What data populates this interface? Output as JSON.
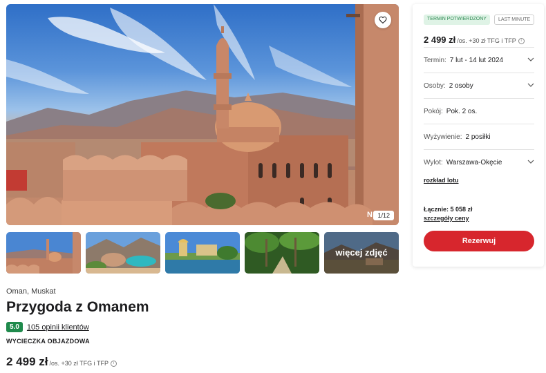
{
  "gallery": {
    "counter": "1/12",
    "corner_text": "N",
    "favorite_icon": "heart-icon",
    "more_photos_label": "więcej zdjęć"
  },
  "offer": {
    "location": "Oman, Muskat",
    "title": "Przygoda z Omanem",
    "rating": "5.0",
    "reviews_link": "105 opinii klientów",
    "trip_type": "WYCIECZKA OBJAZDOWA",
    "price": "2 499 zł",
    "price_suffix": "/os. +30 zł TFG i TFP"
  },
  "booking": {
    "tags": [
      "TERMIN POTWIERDZONY",
      "LAST MINUTE"
    ],
    "price": "2 499 zł",
    "price_suffix": "/os. +30 zł TFG i TFP",
    "fields": {
      "term": {
        "label": "Termin:",
        "value": "7 lut - 14 lut 2024"
      },
      "persons": {
        "label": "Osoby:",
        "value": "2 osoby"
      },
      "room": {
        "label": "Pokój:",
        "value": "Pok. 2 os."
      },
      "board": {
        "label": "Wyżywienie:",
        "value": "2 posiłki"
      },
      "departure": {
        "label": "Wylot:",
        "value": "Warszawa-Okęcie"
      }
    },
    "flight_schedule_link": "rozkład lotu",
    "total": "Łącznie: 5 058 zł",
    "price_details_link": "szczegóły ceny",
    "book_button": "Rezerwuj"
  },
  "colors": {
    "accent_red": "#d7262d",
    "rating_green": "#1f8a4c",
    "confirmed_tag_green": "#dff3e6"
  }
}
